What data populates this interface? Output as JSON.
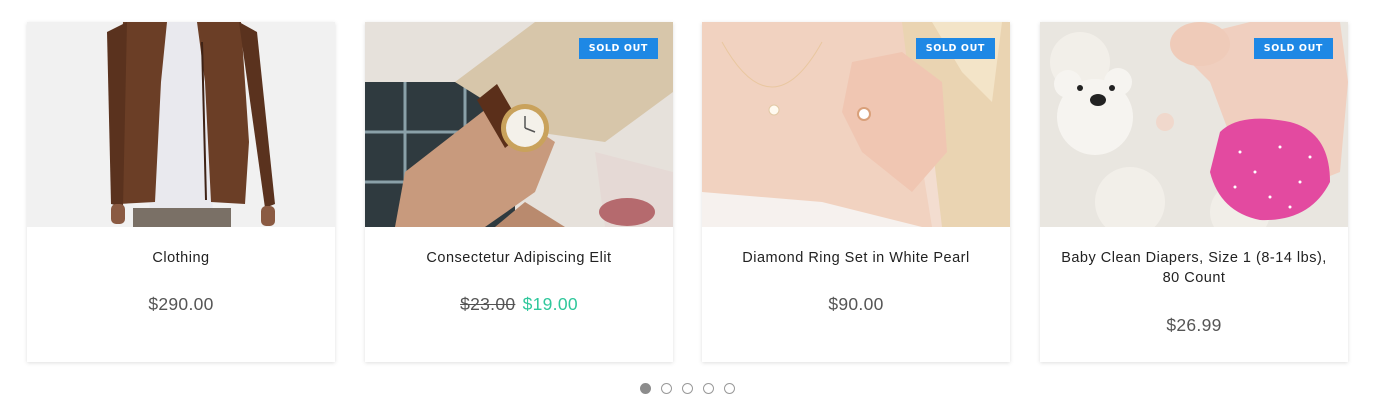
{
  "products": [
    {
      "title": "Clothing",
      "price": "$290.00",
      "image": "leather-jacket-photo"
    },
    {
      "title": "Consectetur Adipiscing Elit",
      "badge": "SOLD OUT",
      "old_price": "$23.00",
      "sale_price": "$19.00",
      "image": "wrist-watch-photo"
    },
    {
      "title": "Diamond Ring Set in White Pearl",
      "badge": "SOLD OUT",
      "price": "$90.00",
      "image": "diamond-ring-photo"
    },
    {
      "title": "Baby Clean Diapers, Size 1 (8-14 lbs), 80 Count",
      "badge": "SOLD OUT",
      "price": "$26.99",
      "image": "baby-diaper-photo"
    }
  ],
  "pagination": {
    "pages": 5,
    "active_index": 0
  },
  "colors": {
    "badge": "#1e88e5",
    "sale_price": "#2fc79b",
    "dot_active": "#8c8c8c"
  }
}
